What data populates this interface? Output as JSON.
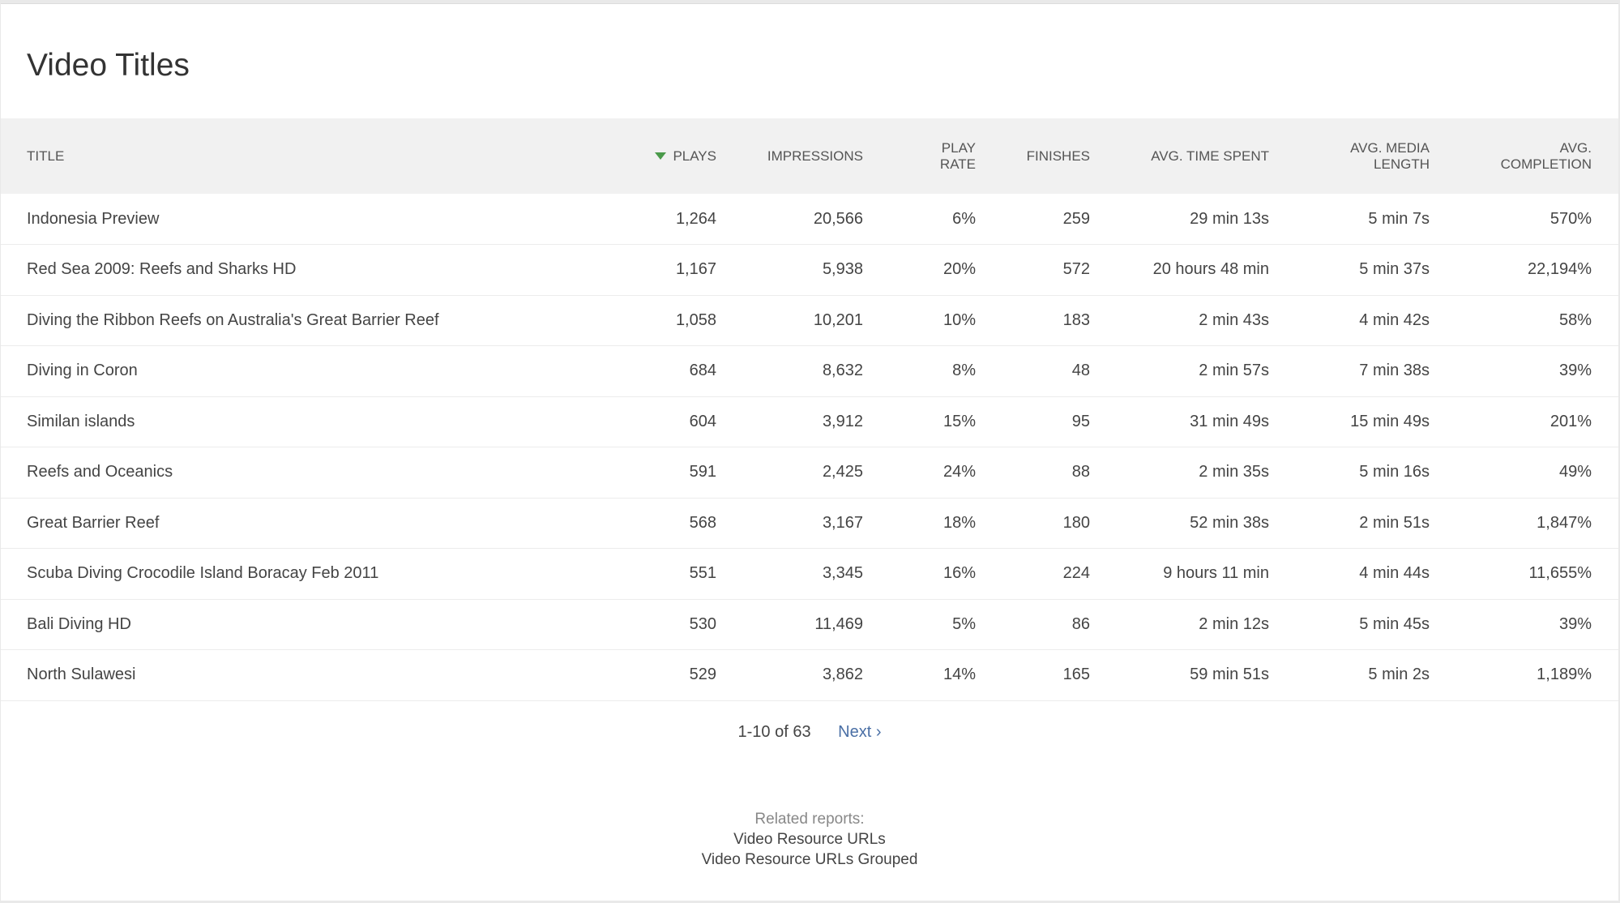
{
  "page": {
    "title": "Video Titles"
  },
  "table": {
    "headers": {
      "title": "TITLE",
      "plays": "PLAYS",
      "impressions": "IMPRESSIONS",
      "play_rate_1": "PLAY",
      "play_rate_2": "RATE",
      "finishes": "FINISHES",
      "avg_time_spent": "AVG. TIME SPENT",
      "avg_media_length_1": "AVG. MEDIA",
      "avg_media_length_2": "LENGTH",
      "avg_completion_1": "AVG.",
      "avg_completion_2": "COMPLETION"
    },
    "sort": {
      "column": "plays",
      "direction": "descending",
      "icon": "sort-desc-icon",
      "color": "#4a9a4a"
    },
    "rows": [
      {
        "title": "Indonesia Preview",
        "plays": "1,264",
        "impressions": "20,566",
        "play_rate": "6%",
        "finishes": "259",
        "avg_time_spent": "29 min 13s",
        "avg_media_length": "5 min 7s",
        "avg_completion": "570%"
      },
      {
        "title": "Red Sea 2009: Reefs and Sharks HD",
        "plays": "1,167",
        "impressions": "5,938",
        "play_rate": "20%",
        "finishes": "572",
        "avg_time_spent": "20 hours 48 min",
        "avg_media_length": "5 min 37s",
        "avg_completion": "22,194%"
      },
      {
        "title": "Diving the Ribbon Reefs on Australia's Great Barrier Reef",
        "plays": "1,058",
        "impressions": "10,201",
        "play_rate": "10%",
        "finishes": "183",
        "avg_time_spent": "2 min 43s",
        "avg_media_length": "4 min 42s",
        "avg_completion": "58%"
      },
      {
        "title": "Diving in Coron",
        "plays": "684",
        "impressions": "8,632",
        "play_rate": "8%",
        "finishes": "48",
        "avg_time_spent": "2 min 57s",
        "avg_media_length": "7 min 38s",
        "avg_completion": "39%"
      },
      {
        "title": "Similan islands",
        "plays": "604",
        "impressions": "3,912",
        "play_rate": "15%",
        "finishes": "95",
        "avg_time_spent": "31 min 49s",
        "avg_media_length": "15 min 49s",
        "avg_completion": "201%"
      },
      {
        "title": "Reefs and Oceanics",
        "plays": "591",
        "impressions": "2,425",
        "play_rate": "24%",
        "finishes": "88",
        "avg_time_spent": "2 min 35s",
        "avg_media_length": "5 min 16s",
        "avg_completion": "49%"
      },
      {
        "title": "Great Barrier Reef",
        "plays": "568",
        "impressions": "3,167",
        "play_rate": "18%",
        "finishes": "180",
        "avg_time_spent": "52 min 38s",
        "avg_media_length": "2 min 51s",
        "avg_completion": "1,847%"
      },
      {
        "title": "Scuba Diving Crocodile Island Boracay Feb 2011",
        "plays": "551",
        "impressions": "3,345",
        "play_rate": "16%",
        "finishes": "224",
        "avg_time_spent": "9 hours 11 min",
        "avg_media_length": "4 min 44s",
        "avg_completion": "11,655%"
      },
      {
        "title": "Bali Diving HD",
        "plays": "530",
        "impressions": "11,469",
        "play_rate": "5%",
        "finishes": "86",
        "avg_time_spent": "2 min 12s",
        "avg_media_length": "5 min 45s",
        "avg_completion": "39%"
      },
      {
        "title": "North Sulawesi",
        "plays": "529",
        "impressions": "3,862",
        "play_rate": "14%",
        "finishes": "165",
        "avg_time_spent": "59 min 51s",
        "avg_media_length": "5 min 2s",
        "avg_completion": "1,189%"
      }
    ]
  },
  "pagination": {
    "range": "1-10 of 63",
    "next_label": "Next ›"
  },
  "related": {
    "label": "Related reports:",
    "links": [
      "Video Resource URLs",
      "Video Resource URLs Grouped"
    ]
  },
  "colors": {
    "link": "#4a6fa5",
    "header_bg": "#f1f1f1",
    "text": "#444444"
  }
}
